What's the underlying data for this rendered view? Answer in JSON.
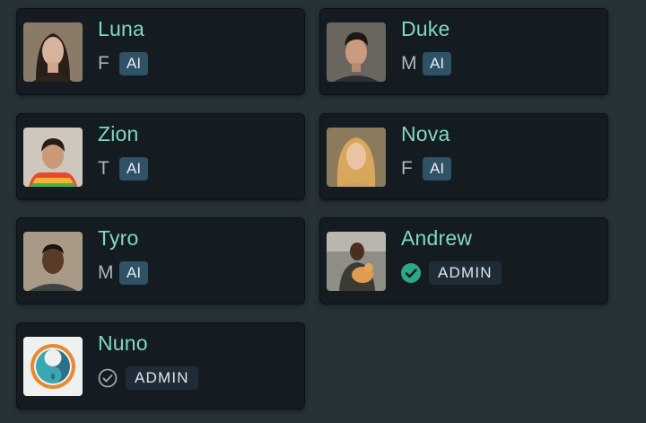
{
  "cards": [
    {
      "name": "Luna",
      "gender": "F",
      "badge": "AI"
    },
    {
      "name": "Duke",
      "gender": "M",
      "badge": "AI"
    },
    {
      "name": "Zion",
      "gender": "T",
      "badge": "AI"
    },
    {
      "name": "Nova",
      "gender": "F",
      "badge": "AI"
    },
    {
      "name": "Tyro",
      "gender": "M",
      "badge": "AI"
    },
    {
      "name": "Andrew",
      "badge": "ADMIN",
      "verified": true,
      "verified_icon": "filled-check-circle-icon"
    },
    {
      "name": "Nuno",
      "badge": "ADMIN",
      "verified": false,
      "verified_icon": "outline-check-circle-icon"
    }
  ],
  "colors": {
    "name": "#7fd7c8",
    "ai_badge": "#2f5266",
    "admin_badge": "#1f2c37",
    "verified": "#2aa888"
  }
}
